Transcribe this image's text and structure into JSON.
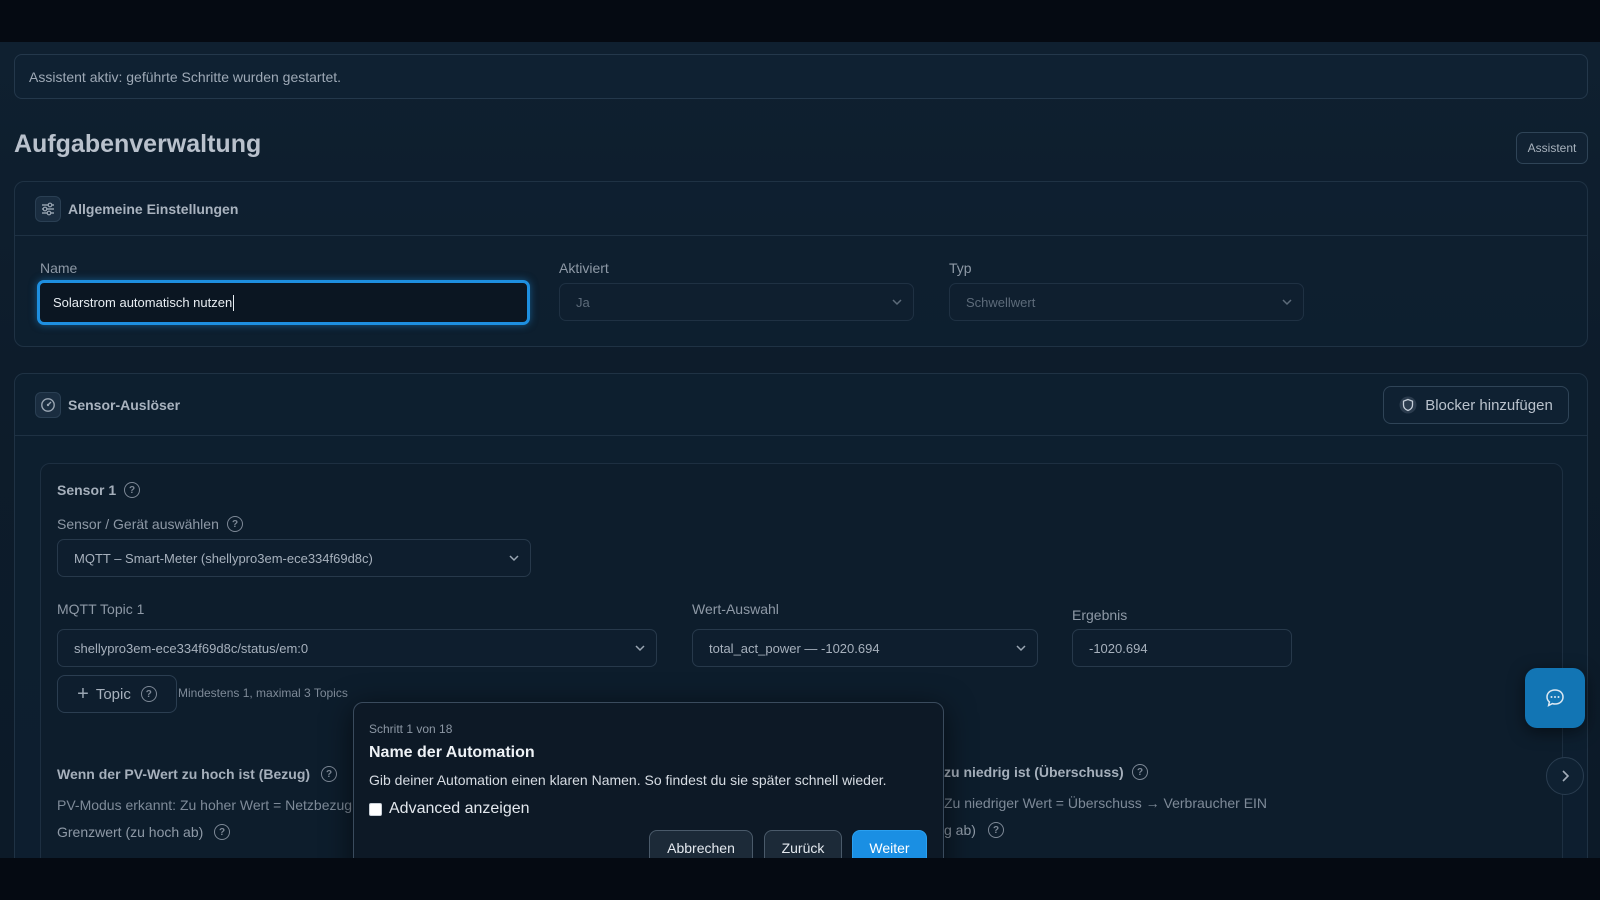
{
  "banner": {
    "text": "Assistent aktiv: geführte Schritte wurden gestartet."
  },
  "header": {
    "title": "Aufgabenverwaltung",
    "assistant_button": "Assistent"
  },
  "general": {
    "section_title": "Allgemeine Einstellungen",
    "name_label": "Name",
    "name_value": "Solarstrom automatisch nutzen",
    "enabled_label": "Aktiviert",
    "enabled_value": "Ja",
    "type_label": "Typ",
    "type_value": "Schwellwert"
  },
  "sensor_trigger": {
    "section_title": "Sensor-Auslöser",
    "blocker_button": "Blocker hinzufügen",
    "sensor_title": "Sensor 1",
    "device_label": "Sensor / Gerät auswählen",
    "device_value": "MQTT – Smart-Meter (shellypro3em-ece334f69d8c)",
    "topic_label": "MQTT Topic 1",
    "topic_value": "shellypro3em-ece334f69d8c/status/em:0",
    "value_select_label": "Wert-Auswahl",
    "value_select_value": "total_act_power — -1020.694",
    "result_label": "Ergebnis",
    "result_value": "-1020.694",
    "add_topic_button": "Topic",
    "topic_hint": "Mindestens 1, maximal 3 Topics",
    "high_title": "Wenn der PV-Wert zu hoch ist (Bezug)",
    "high_desc": "PV-Modus erkannt: Zu hoher Wert = Netzbezug",
    "high_threshold_label": "Grenzwert (zu hoch ab)",
    "low_title": "zu niedrig ist (Überschuss)",
    "low_desc": "Zu niedriger Wert = Überschuss → Verbraucher EIN",
    "low_threshold_label": "g ab)"
  },
  "wizard": {
    "step": "Schritt 1 von 18",
    "title": "Name der Automation",
    "description": "Gib deiner Automation einen klaren Namen. So findest du sie später schnell wieder.",
    "checkbox_label": "Advanced anzeigen",
    "cancel_button": "Abbrechen",
    "back_button": "Zurück",
    "next_button": "Weiter"
  },
  "colors": {
    "accent": "#1a8fe3",
    "focus_ring": "#1e8fe0",
    "background": "#0c1a28"
  },
  "icons": [
    "sliders-icon",
    "gauge-icon",
    "shield-icon",
    "help-icon",
    "chevron-down-icon",
    "plus-icon",
    "chat-icon",
    "chevron-right-icon"
  ]
}
